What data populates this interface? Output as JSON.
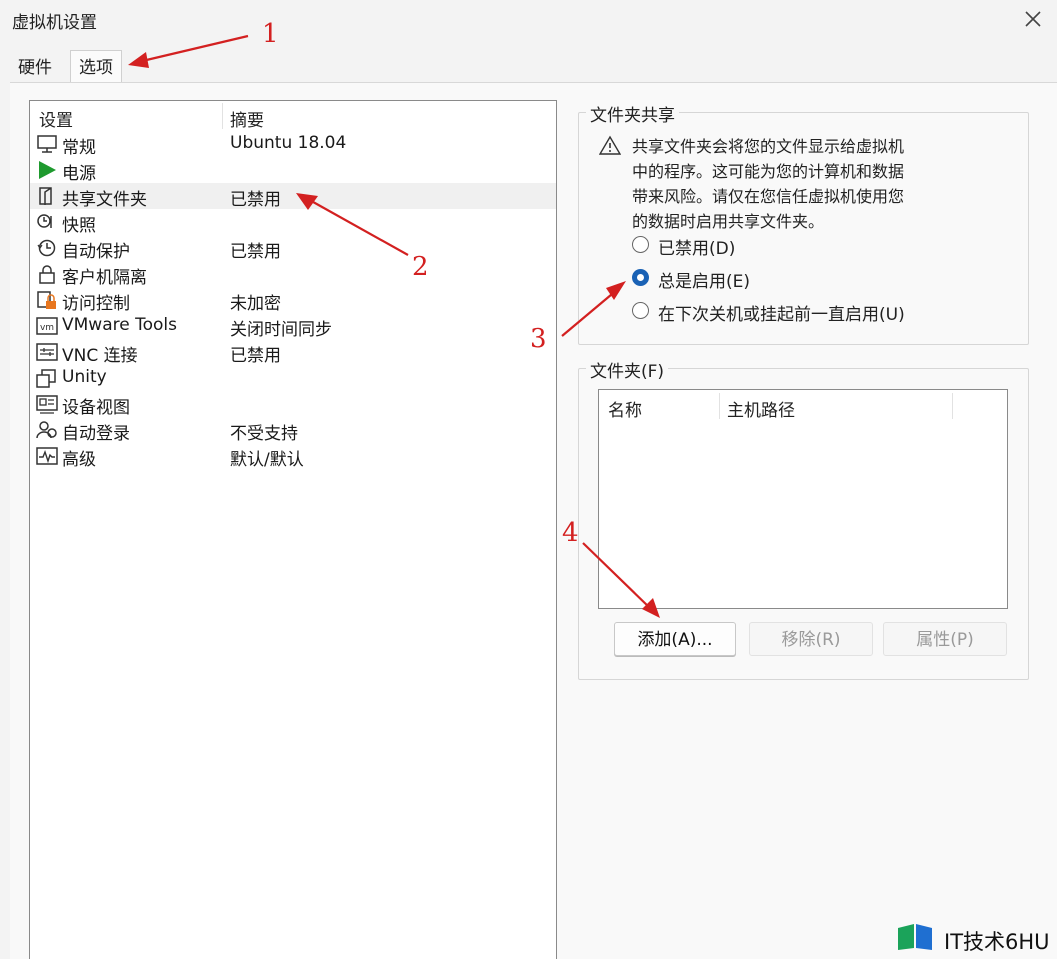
{
  "window": {
    "title": "虚拟机设置"
  },
  "tabs": [
    {
      "label": "硬件"
    },
    {
      "label": "选项"
    }
  ],
  "list": {
    "header": {
      "setting": "设置",
      "summary": "摘要"
    },
    "items": [
      {
        "label": "常规",
        "summary": "Ubuntu 18.04",
        "icon": "monitor-icon"
      },
      {
        "label": "电源",
        "summary": "",
        "icon": "play-icon"
      },
      {
        "label": "共享文件夹",
        "summary": "已禁用",
        "icon": "shared-folder-icon"
      },
      {
        "label": "快照",
        "summary": "",
        "icon": "snapshot-icon"
      },
      {
        "label": "自动保护",
        "summary": "已禁用",
        "icon": "clock-icon"
      },
      {
        "label": "客户机隔离",
        "summary": "",
        "icon": "lock-icon"
      },
      {
        "label": "访问控制",
        "summary": "未加密",
        "icon": "access-control-icon"
      },
      {
        "label": "VMware Tools",
        "summary": "关闭时间同步",
        "icon": "vm-icon"
      },
      {
        "label": "VNC 连接",
        "summary": "已禁用",
        "icon": "vnc-icon"
      },
      {
        "label": "Unity",
        "summary": "",
        "icon": "unity-icon"
      },
      {
        "label": "设备视图",
        "summary": "",
        "icon": "device-view-icon"
      },
      {
        "label": "自动登录",
        "summary": "不受支持",
        "icon": "users-icon"
      },
      {
        "label": "高级",
        "summary": "默认/默认",
        "icon": "pulse-icon"
      }
    ],
    "selected": "共享文件夹"
  },
  "sharing": {
    "group_title": "文件夹共享",
    "warning": "共享文件夹会将您的文件显示给虚拟机中的程序。这可能为您的计算机和数据带来风险。请仅在您信任虚拟机使用您的数据时启用共享文件夹。",
    "warning_lines": [
      "共享文件夹会将您的文件显示给虚拟机",
      "中的程序。这可能为您的计算机和数据",
      "带来风险。请仅在您信任虚拟机使用您",
      "的数据时启用共享文件夹。"
    ],
    "options": [
      {
        "label": "已禁用(D)",
        "selected": false
      },
      {
        "label": "总是启用(E)",
        "selected": true
      },
      {
        "label": "在下次关机或挂起前一直启用(U)",
        "selected": false
      }
    ]
  },
  "folders": {
    "group_title": "文件夹(F)",
    "columns": [
      "名称",
      "主机路径"
    ],
    "rows": [],
    "buttons": {
      "add": "添加(A)...",
      "remove": "移除(R)",
      "properties": "属性(P)"
    }
  },
  "annotations": [
    "1",
    "2",
    "3",
    "4"
  ],
  "watermark": {
    "text": "IT技术6HU"
  },
  "colors": {
    "accent": "#1a62b5",
    "annotation": "#d32020",
    "play": "#1e9a2e"
  }
}
